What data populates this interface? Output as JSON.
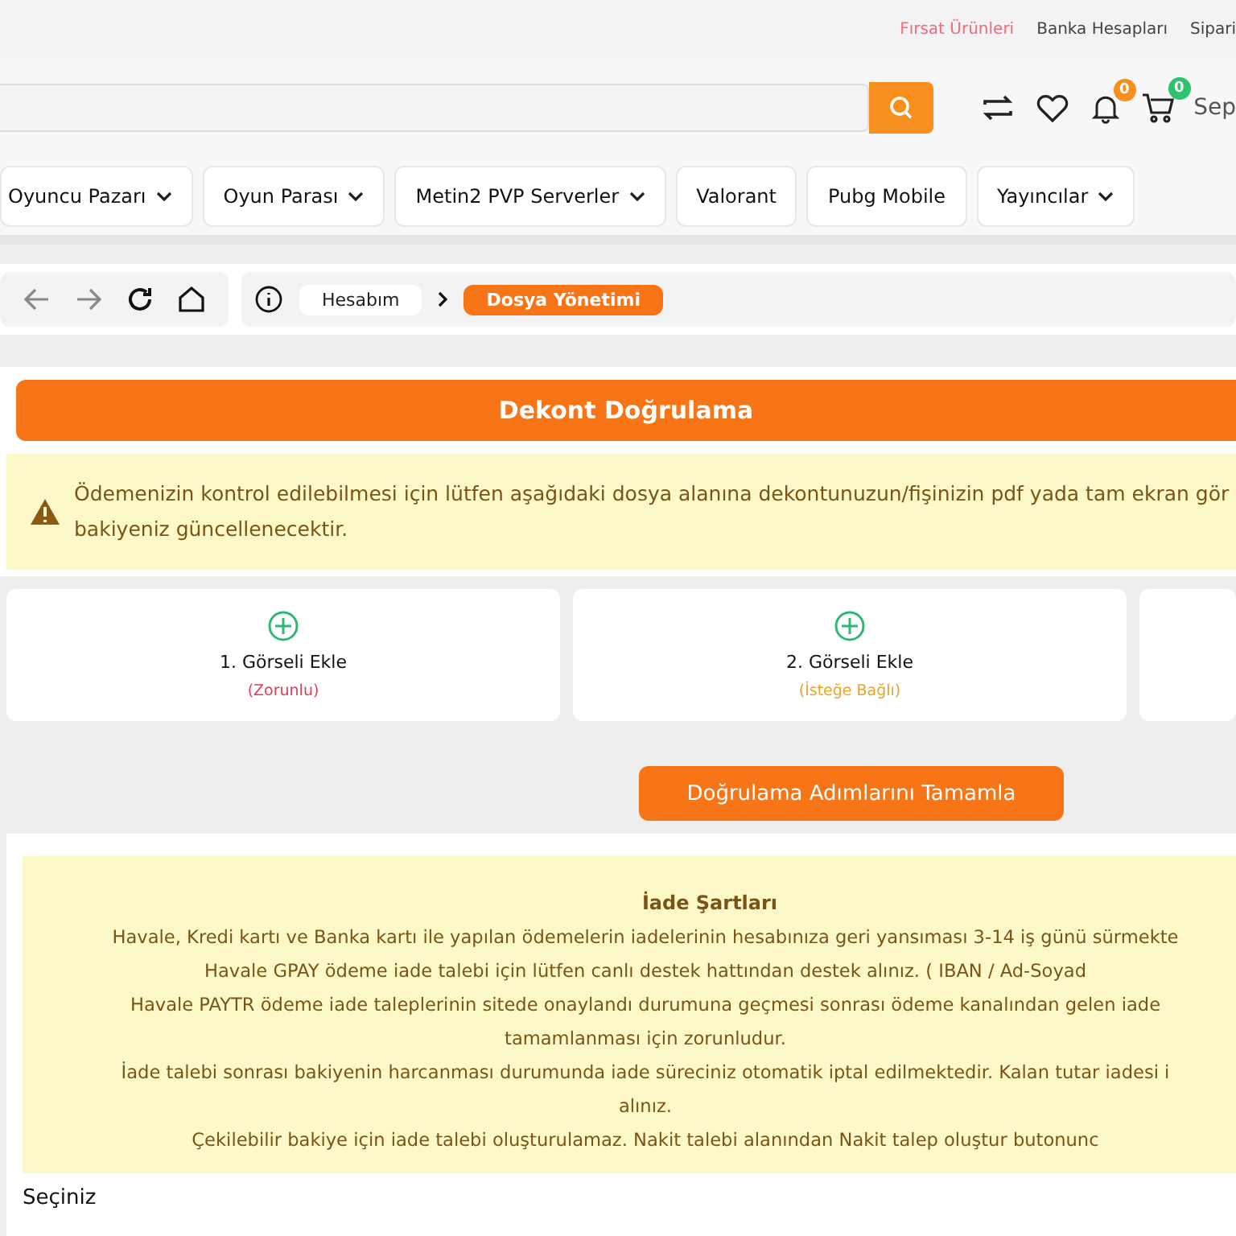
{
  "top_links": [
    {
      "label": "Fırsat Ürünleri",
      "kind": "highlight"
    },
    {
      "label": "Banka Hesapları",
      "kind": "plain"
    },
    {
      "label": "Sipari",
      "kind": "plain"
    }
  ],
  "header": {
    "notification_count": "0",
    "cart_count": "0",
    "cart_label": "Sep"
  },
  "categories": [
    {
      "label": "Oyuncu Pazarı",
      "dropdown": true
    },
    {
      "label": "Oyun Parası",
      "dropdown": true
    },
    {
      "label": "Metin2 PVP Serverler",
      "dropdown": true
    },
    {
      "label": "Valorant",
      "dropdown": false
    },
    {
      "label": "Pubg Mobile",
      "dropdown": false
    },
    {
      "label": "Yayıncılar",
      "dropdown": true
    }
  ],
  "breadcrumb": [
    {
      "label": "Hesabım",
      "selected": false
    },
    {
      "label": "Dosya Yönetimi",
      "selected": true
    }
  ],
  "title": "Dekont Doğrulama",
  "alert": "Ödemenizin kontrol edilebilmesi için lütfen aşağıdaki dosya alanına dekontunuzun/fişinizin pdf yada tam ekran gör bakiyeniz güncellenecektir.",
  "uploads": [
    {
      "label": "1. Görseli Ekle",
      "note": "(Zorunlu)",
      "kind": "required"
    },
    {
      "label": "2. Görseli Ekle",
      "note": "(İsteğe Bağlı)",
      "kind": "optional"
    },
    {
      "kind": "empty"
    }
  ],
  "submit_button": "Doğrulama Adımlarını Tamamla",
  "refund": {
    "title": "İade Şartları",
    "lines": [
      "Havale, Kredi kartı ve Banka kartı ile yapılan ödemelerin iadelerinin hesabınıza geri yansıması 3-14 iş günü sürmekte",
      "Havale GPAY ödeme iade talebi için lütfen canlı destek hattından destek alınız. ( IBAN / Ad-Soyad",
      "Havale PAYTR ödeme iade taleplerinin sitede onaylandı durumuna geçmesi sonrası ödeme kanalından gelen iade",
      "tamamlanması için zorunludur.",
      "İade talebi sonrası bakiyenin harcanması durumunda iade süreciniz otomatik iptal edilmektedir. Kalan tutar iadesi i",
      "alınız.",
      "Çekilebilir bakiye için iade talebi oluşturulamaz. Nakit talebi alanından Nakit talep oluştur butonunc"
    ]
  },
  "select_label": "Seçiniz"
}
